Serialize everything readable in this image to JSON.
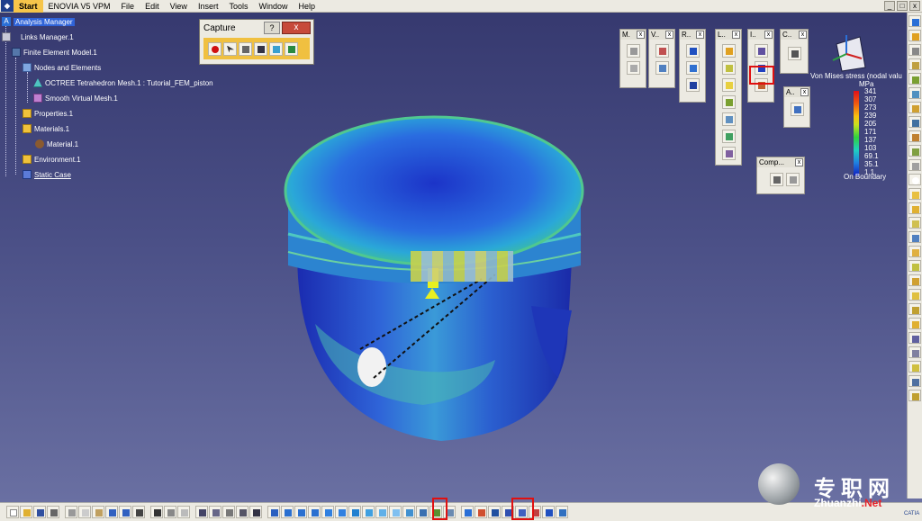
{
  "menu": {
    "items": [
      "Start",
      "ENOVIA V5 VPM",
      "File",
      "Edit",
      "View",
      "Insert",
      "Tools",
      "Window",
      "Help"
    ],
    "window_controls": [
      "_",
      "□",
      "x"
    ]
  },
  "tree": {
    "items": [
      {
        "label": "Analysis Manager",
        "icon": "analysis-icon"
      },
      {
        "label": "Links Manager.1",
        "icon": "link-icon"
      },
      {
        "label": "Finite Element Model.1",
        "icon": "fem-icon"
      },
      {
        "label": "Nodes and Elements",
        "icon": "nodes-icon"
      },
      {
        "label": "OCTREE Tetrahedron Mesh.1 : Tutorial_FEM_piston",
        "icon": "tetra-mesh-icon"
      },
      {
        "label": "Smooth Virtual Mesh.1",
        "icon": "smooth-mesh-icon"
      },
      {
        "label": "Properties.1",
        "icon": "folder-icon"
      },
      {
        "label": "Materials.1",
        "icon": "folder-icon"
      },
      {
        "label": "Material.1",
        "icon": "material-icon"
      },
      {
        "label": "Environment.1",
        "icon": "folder-icon"
      },
      {
        "label": "Static Case",
        "icon": "static-case-icon"
      }
    ]
  },
  "capture": {
    "title": "Capture",
    "help": "?",
    "close": "x"
  },
  "toolbars": [
    {
      "title": "M.",
      "close": "x"
    },
    {
      "title": "V..",
      "close": "x"
    },
    {
      "title": "R..",
      "close": "x"
    },
    {
      "title": "L..",
      "close": "x"
    },
    {
      "title": "I..",
      "close": "x"
    },
    {
      "title": "C..",
      "close": "x"
    },
    {
      "title": "A..",
      "close": "x"
    },
    {
      "title": "Comp...",
      "close": "x"
    }
  ],
  "legend": {
    "title": "Von Mises stress (nodal valu",
    "unit": "MPa",
    "values": [
      "341",
      "307",
      "273",
      "239",
      "205",
      "171",
      "137",
      "103",
      "69.1",
      "35.1",
      "1.1"
    ],
    "footer": "On Boundary"
  },
  "watermark": {
    "zh": "专职网",
    "domain_a": "Zhuanzhi",
    "domain_b": ".Net"
  },
  "brand": "CATIA",
  "colors": {
    "background_top": "#35386e",
    "background_bottom": "#6c72a4",
    "highlight": "#e01010",
    "selection": "#2f63d8"
  }
}
